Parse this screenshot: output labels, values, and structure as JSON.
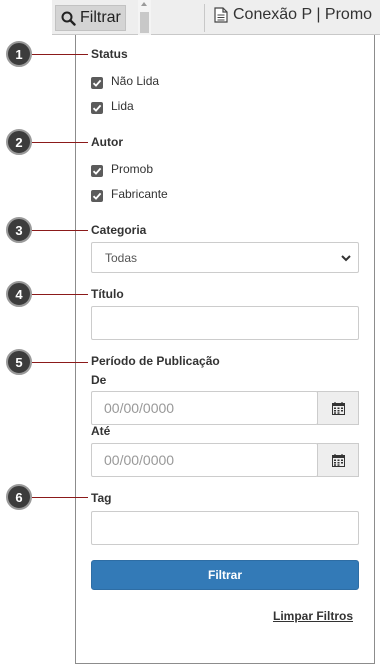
{
  "topbar": {
    "filter_tab_label": "Filtrar",
    "doc_tab_label": "Conexão P | Promo"
  },
  "callouts": [
    "1",
    "2",
    "3",
    "4",
    "5",
    "6"
  ],
  "filters": {
    "status_label": "Status",
    "status_options": [
      {
        "label": "Não Lida",
        "checked": true
      },
      {
        "label": "Lida",
        "checked": true
      }
    ],
    "author_label": "Autor",
    "author_options": [
      {
        "label": "Promob",
        "checked": true
      },
      {
        "label": "Fabricante",
        "checked": true
      }
    ],
    "category_label": "Categoria",
    "category_selected": "Todas",
    "title_label": "Título",
    "title_value": "",
    "period_label": "Período de Publicação",
    "from_label": "De",
    "from_placeholder": "00/00/0000",
    "to_label": "Até",
    "to_placeholder": "00/00/0000",
    "tag_label": "Tag",
    "tag_value": "",
    "submit_label": "Filtrar",
    "clear_label": "Limpar Filtros"
  },
  "colors": {
    "primary": "#337ab7",
    "callout_line": "#8b1a1a",
    "checkbox": "#5b5b5b"
  },
  "icons": {
    "filter_tab": "search-icon",
    "doc_tab": "document-icon",
    "date": "calendar-icon",
    "select": "chevron-down-icon",
    "checkbox": "check-icon"
  }
}
